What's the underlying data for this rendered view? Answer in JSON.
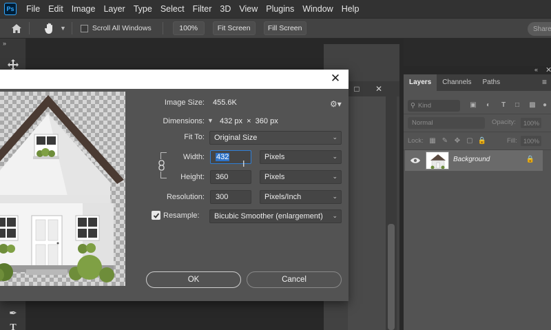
{
  "app": {
    "logo": "Ps",
    "menu": [
      "File",
      "Edit",
      "Image",
      "Layer",
      "Type",
      "Select",
      "Filter",
      "3D",
      "View",
      "Plugins",
      "Window",
      "Help"
    ]
  },
  "options_bar": {
    "scroll_all_windows": "Scroll All Windows",
    "zoom_100": "100%",
    "fit_screen": "Fit Screen",
    "fill_screen": "Fill Screen",
    "share": "Share"
  },
  "layers_panel": {
    "tabs": [
      "Layers",
      "Channels",
      "Paths"
    ],
    "kind_placeholder": "Kind",
    "blend_mode": "Normal",
    "opacity_label": "Opacity:",
    "opacity_value": "100%",
    "lock_label": "Lock:",
    "fill_label": "Fill:",
    "fill_value": "100%",
    "layer_name": "Background"
  },
  "dialog": {
    "image_size_label": "Image Size:",
    "image_size_value": "455.6K",
    "dimensions_label": "Dimensions:",
    "dimensions_value": "432 px  ×  360 px",
    "fit_to_label": "Fit To:",
    "fit_to_value": "Original Size",
    "width_label": "Width:",
    "width_value": "432",
    "width_unit": "Pixels",
    "height_label": "Height:",
    "height_value": "360",
    "height_unit": "Pixels",
    "resolution_label": "Resolution:",
    "resolution_value": "300",
    "resolution_unit": "Pixels/Inch",
    "resample_label": "Resample:",
    "resample_checked": true,
    "resample_value": "Bicubic Smoother (enlargement)",
    "ok": "OK",
    "cancel": "Cancel"
  }
}
